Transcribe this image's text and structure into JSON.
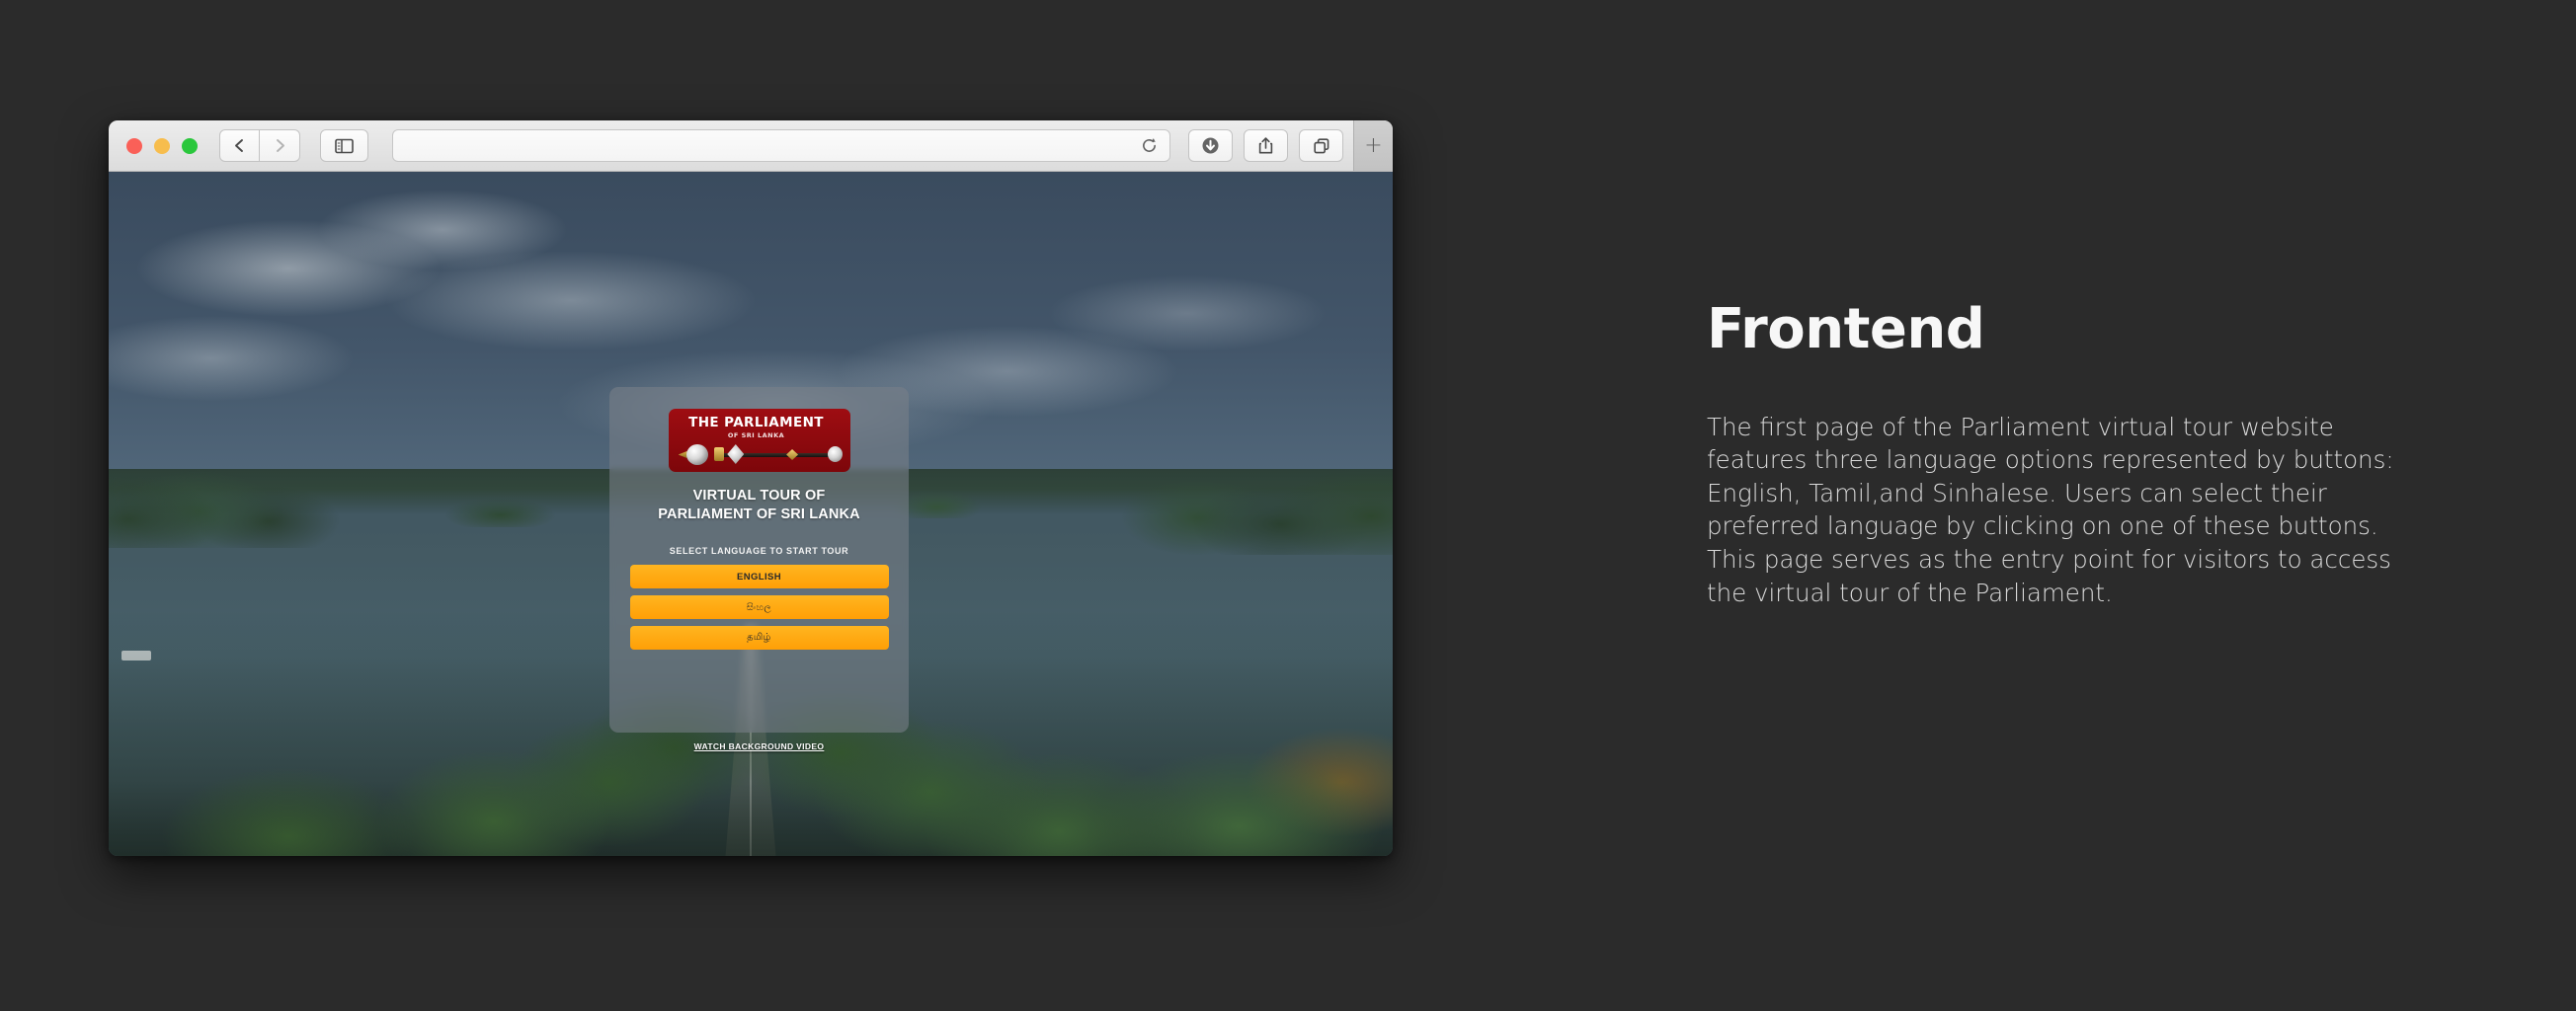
{
  "browser": {
    "traffic_lights": [
      {
        "name": "close",
        "color": "#fa6058"
      },
      {
        "name": "minimize",
        "color": "#f7bd4d"
      },
      {
        "name": "maximize",
        "color": "#2ac73c"
      }
    ],
    "back_icon": "chevron-left-icon",
    "forward_icon": "chevron-right-icon",
    "sidebar_icon": "sidebar-icon",
    "address": {
      "value": "",
      "placeholder": ""
    },
    "reload_icon": "reload-icon",
    "downloads_icon": "downloads-icon",
    "share_icon": "share-icon",
    "tab_overview_icon": "tab-overview-icon",
    "new_tab_label": "+"
  },
  "page": {
    "logo": {
      "title": "THE PARLIAMENT",
      "subtitle": "OF SRI LANKA",
      "badge_color": "#8d0a10"
    },
    "card_title_line1": "VIRTUAL TOUR OF",
    "card_title_line2": "PARLIAMENT OF SRI LANKA",
    "select_language_label": "SELECT LANGUAGE TO START TOUR",
    "languages": [
      {
        "label": "ENGLISH",
        "name": "english"
      },
      {
        "label": "සිංහල",
        "name": "sinhala"
      },
      {
        "label": "தமிழ்",
        "name": "tamil"
      }
    ],
    "watch_video_label": "WATCH BACKGROUND VIDEO",
    "accent_color": "#ffa80d"
  },
  "info": {
    "heading": "Frontend",
    "body": "The first page of the Parliament virtual tour website features three language options represented by buttons: English, Tamil,and Sinhalese. Users can select their preferred language by clicking on one of these buttons. This page serves as the entry point for visitors to access the virtual tour of the Parliament."
  },
  "theme": {
    "page_background": "#2b2b2b",
    "heading_color": "#f7f7f7",
    "body_color": "#dadada"
  }
}
